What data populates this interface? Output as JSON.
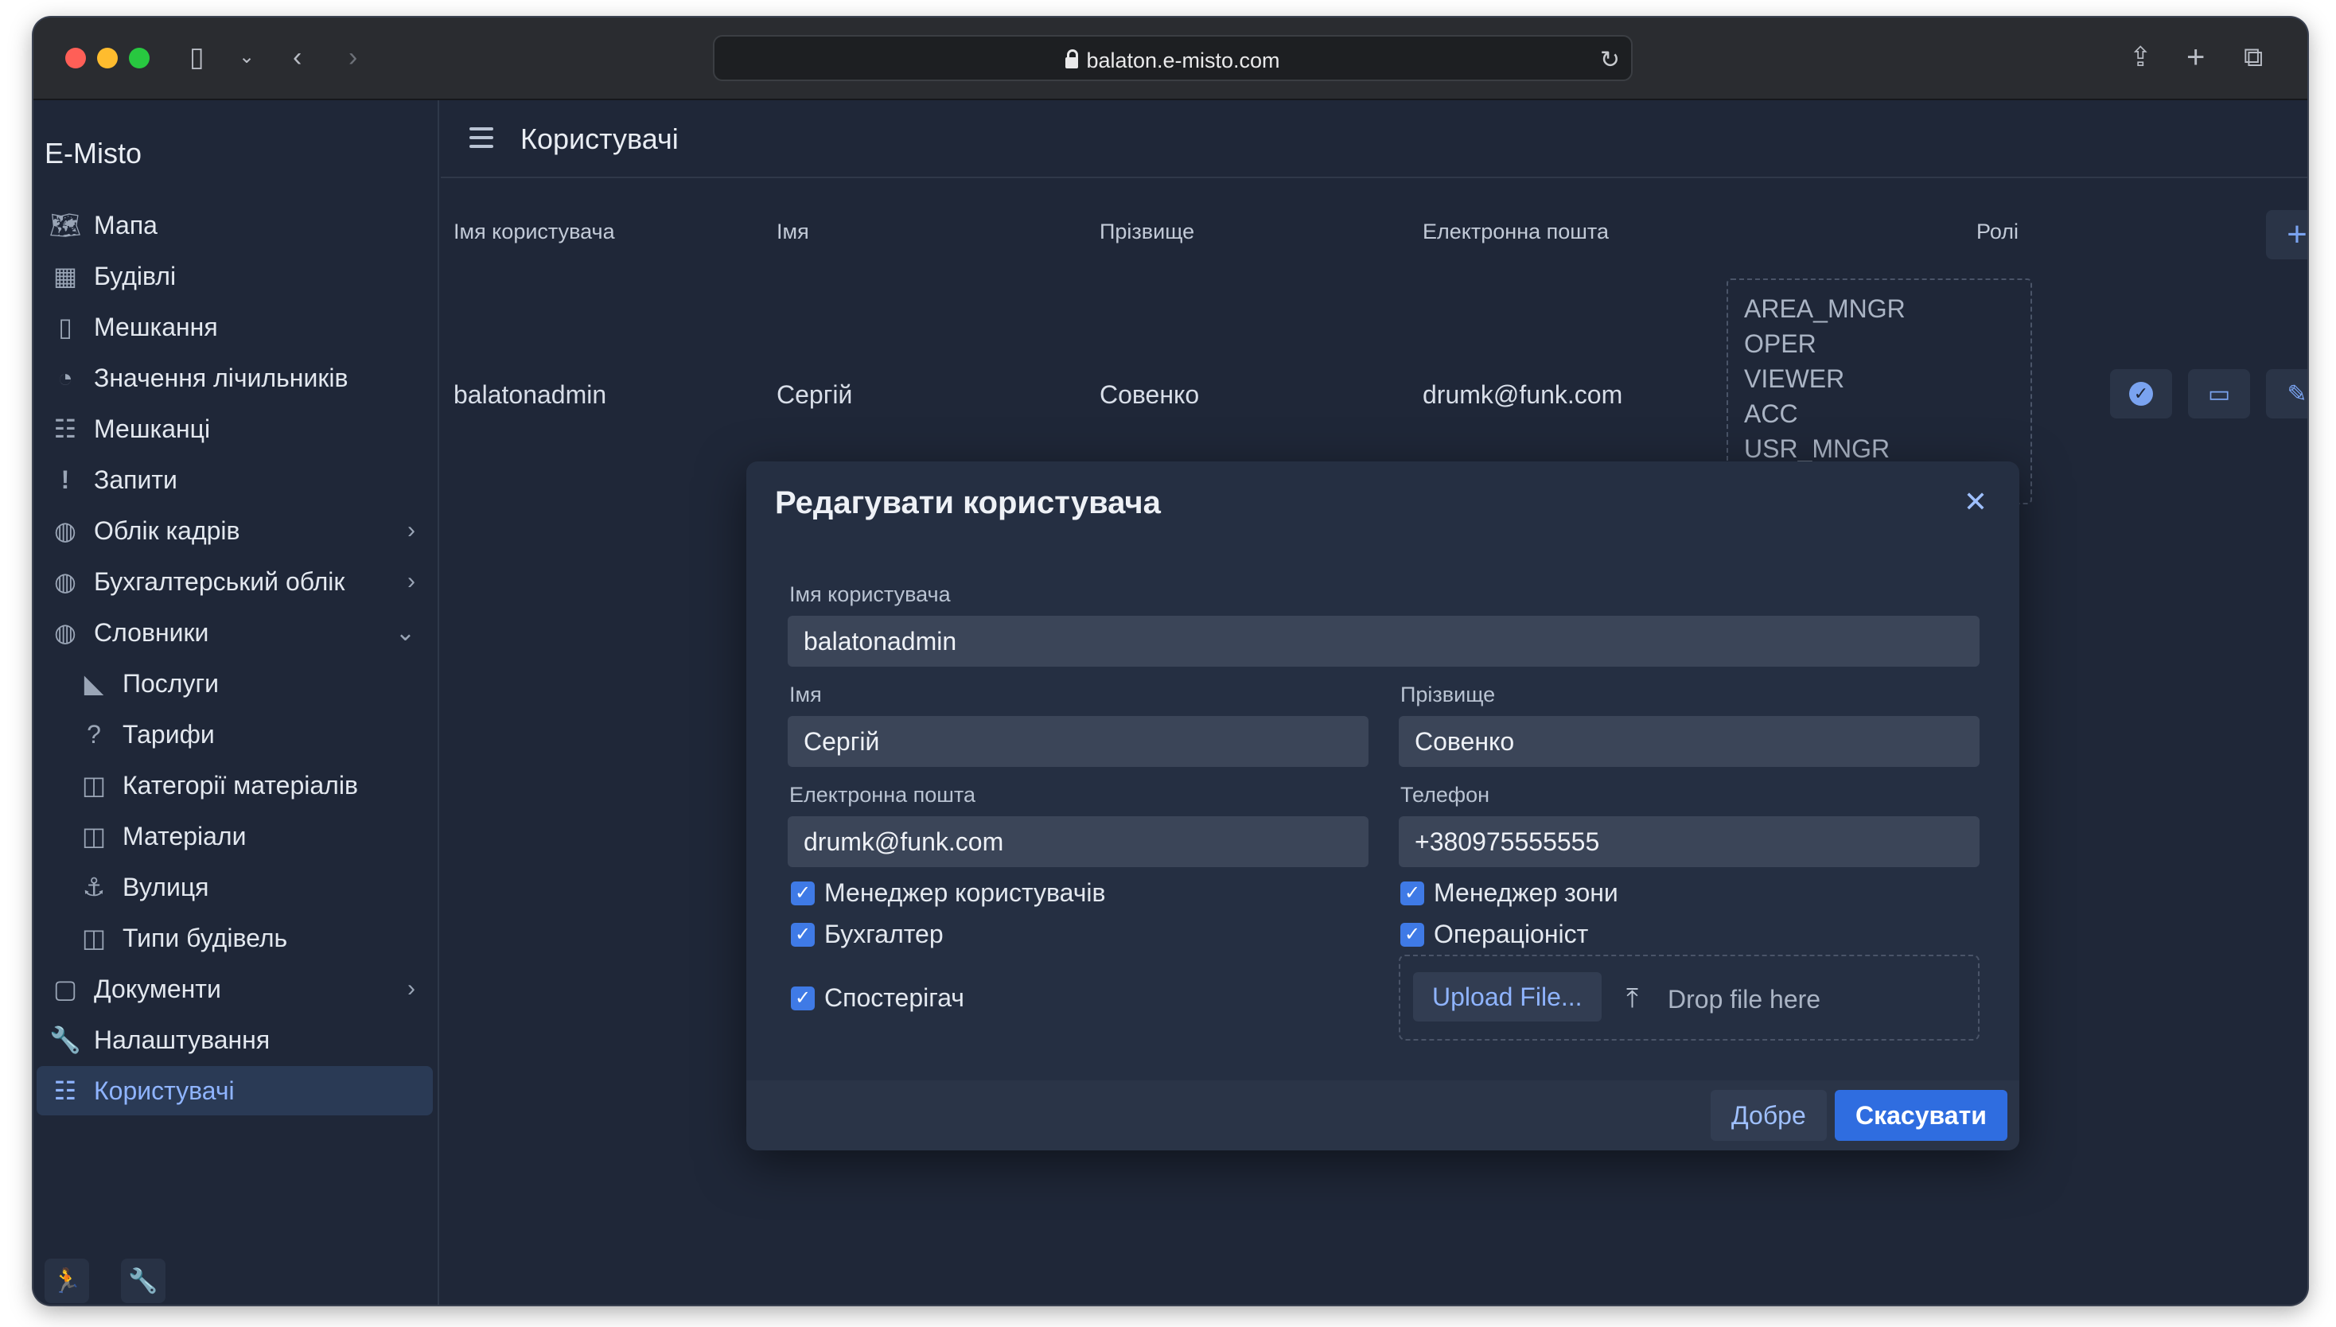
{
  "browser": {
    "url": "balaton.e-misto.com"
  },
  "sidebar": {
    "brand": "E-Misto",
    "items": [
      {
        "label": "Мапа",
        "icon": "map-icon"
      },
      {
        "label": "Будівлі",
        "icon": "building-icon"
      },
      {
        "label": "Мешкання",
        "icon": "door-icon"
      },
      {
        "label": "Значення лічильників",
        "icon": "gauge-icon"
      },
      {
        "label": "Мешканці",
        "icon": "users-icon"
      },
      {
        "label": "Запити",
        "icon": "exclamation-icon"
      },
      {
        "label": "Облік кадрів",
        "icon": "globe-icon"
      },
      {
        "label": "Бухгалтерський облік",
        "icon": "globe-icon"
      },
      {
        "label": "Словники",
        "icon": "globe-icon"
      },
      {
        "label": "Послуги",
        "icon": "services-icon"
      },
      {
        "label": "Тарифи",
        "icon": "question-icon"
      },
      {
        "label": "Категорії матеріалів",
        "icon": "book-icon"
      },
      {
        "label": "Матеріали",
        "icon": "book-icon"
      },
      {
        "label": "Вулиця",
        "icon": "anchor-icon"
      },
      {
        "label": "Типи будівель",
        "icon": "book-icon"
      },
      {
        "label": "Документи",
        "icon": "document-icon"
      },
      {
        "label": "Налаштування",
        "icon": "wrench-icon"
      },
      {
        "label": "Користувачі",
        "icon": "users-icon"
      }
    ]
  },
  "header": {
    "title": "Користувачі"
  },
  "table": {
    "columns": [
      "Імя користувача",
      "Імя",
      "Прізвище",
      "Електронна пошта",
      "Ролі"
    ],
    "row": {
      "username": "balatonadmin",
      "first_name": "Сергій",
      "last_name": "Совенко",
      "email": "drumk@funk.com",
      "roles": [
        "AREA_MNGR",
        "OPER",
        "VIEWER",
        "ACC",
        "USR_MNGR"
      ]
    }
  },
  "dialog": {
    "title": "Редагувати користувача",
    "username_label": "Імя користувача",
    "username_value": "balatonadmin",
    "first_name_label": "Імя",
    "first_name_value": "Сергій",
    "last_name_label": "Прізвище",
    "last_name_value": "Совенко",
    "email_label": "Електронна пошта",
    "email_value": "drumk@funk.com",
    "phone_label": "Телефон",
    "phone_value": "+380975555555",
    "checkboxes": [
      {
        "label": "Менеджер користувачів",
        "checked": true
      },
      {
        "label": "Менеджер зони",
        "checked": true
      },
      {
        "label": "Бухгалтер",
        "checked": true
      },
      {
        "label": "Операціоніст",
        "checked": true
      },
      {
        "label": "Спостерігач",
        "checked": true
      }
    ],
    "upload_button": "Upload File...",
    "drop_text": "Drop file here",
    "ok_button": "Добре",
    "cancel_button": "Скасувати"
  },
  "colors": {
    "accent": "#3f7ae6",
    "background": "#1f2738",
    "dialog": "#252f42"
  }
}
